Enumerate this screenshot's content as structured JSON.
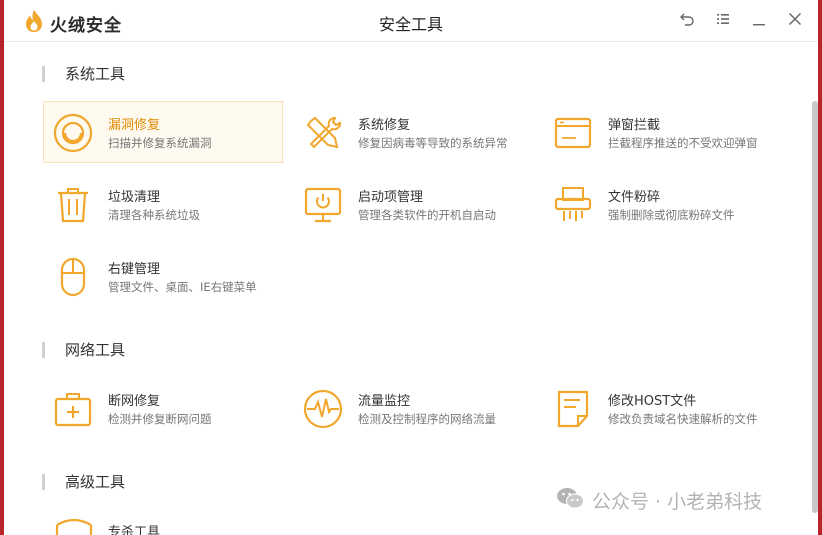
{
  "app": {
    "brand": "火绒安全",
    "window_title": "安全工具"
  },
  "colors": {
    "accent": "#f1a62c",
    "active_text": "#e08a00",
    "background_red": "#b5252a"
  },
  "window_controls": [
    {
      "name": "back-button",
      "icon": "undo-icon"
    },
    {
      "name": "menu-button",
      "icon": "menu-icon"
    },
    {
      "name": "minimize-button",
      "icon": "minimize-icon"
    },
    {
      "name": "close-button",
      "icon": "close-icon"
    }
  ],
  "sections": [
    {
      "title": "系统工具",
      "tools": [
        {
          "name": "漏洞修复",
          "desc": "扫描并修复系统漏洞",
          "icon": "vulnerability-fix-icon",
          "active": true
        },
        {
          "name": "系统修复",
          "desc": "修复因病毒等导致的系统异常",
          "icon": "wrench-screwdriver-icon"
        },
        {
          "name": "弹窗拦截",
          "desc": "拦截程序推送的不受欢迎弹窗",
          "icon": "popup-window-icon"
        },
        {
          "name": "垃圾清理",
          "desc": "清理各种系统垃圾",
          "icon": "trash-can-icon"
        },
        {
          "name": "启动项管理",
          "desc": "管理各类软件的开机自启动",
          "icon": "monitor-power-icon"
        },
        {
          "name": "文件粉碎",
          "desc": "强制删除或彻底粉碎文件",
          "icon": "shredder-icon"
        },
        {
          "name": "右键管理",
          "desc": "管理文件、桌面、IE右键菜单",
          "icon": "mouse-icon"
        }
      ]
    },
    {
      "title": "网络工具",
      "tools": [
        {
          "name": "断网修复",
          "desc": "检测并修复断网问题",
          "icon": "first-aid-kit-icon"
        },
        {
          "name": "流量监控",
          "desc": "检测及控制程序的网络流量",
          "icon": "traffic-wave-icon"
        },
        {
          "name": "修改HOST文件",
          "desc": "修改负责域名快速解析的文件",
          "icon": "document-edit-icon"
        }
      ]
    },
    {
      "title": "高级工具",
      "tools": [
        {
          "name": "专杀工具",
          "icon": "shield-icon"
        }
      ]
    }
  ],
  "watermark": {
    "text": "公众号 · 小老弟科技",
    "icon": "wechat-icon"
  }
}
